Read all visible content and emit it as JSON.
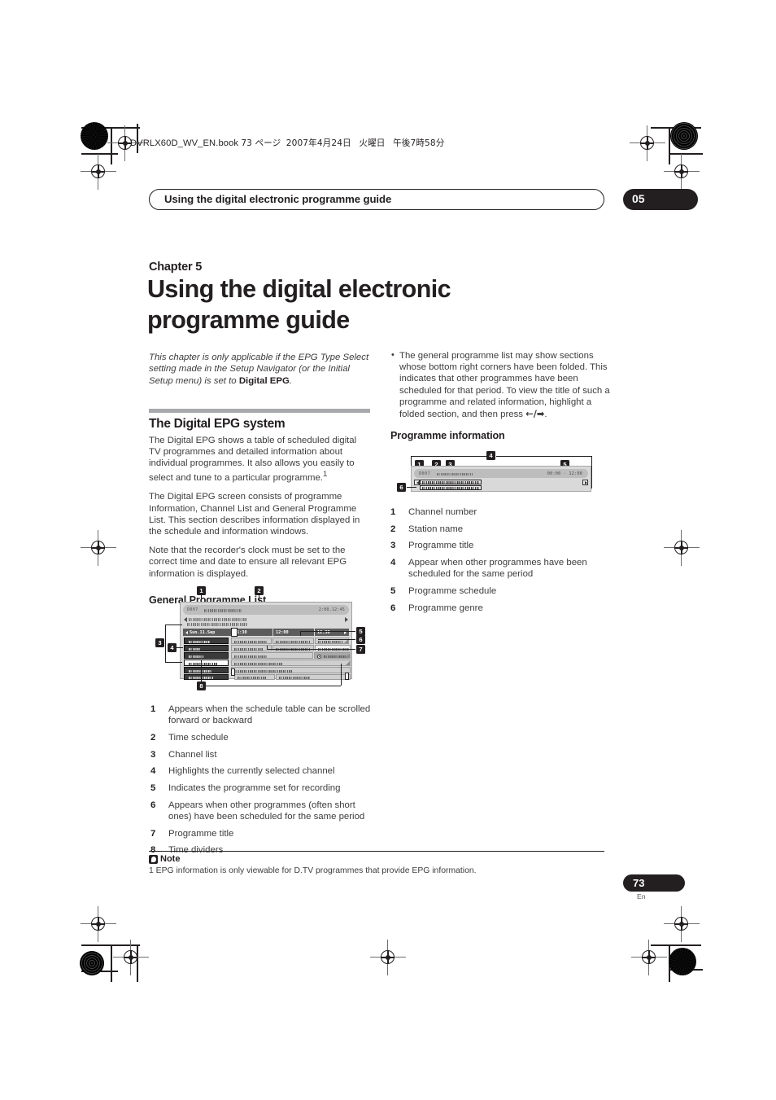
{
  "print_header": {
    "filename": "DVRLX60D_WV_EN.book",
    "page_marker": "73 ページ",
    "date": "2007年4月24日",
    "weekday": "火曜日",
    "time": "午後7時58分"
  },
  "running_head": {
    "title": "Using the digital electronic programme guide",
    "chapter_badge": "05"
  },
  "chapter": {
    "label": "Chapter 5",
    "title": "Using the digital electronic programme guide"
  },
  "left_column": {
    "intro_part1": "This chapter is only applicable if the EPG Type Select setting made in the Setup Navigator (or the Initial Setup menu) is set to ",
    "intro_bold": "Digital EPG",
    "intro_part2": ".",
    "section_title": "The Digital EPG system",
    "paragraphs": [
      "The Digital EPG shows a table of scheduled digital TV programmes and detailed information about individual programmes. It also allows you easily to select and tune to a particular programme.",
      "The Digital EPG screen consists of programme Information, Channel List and General Programme List. This section describes information displayed in the schedule and information windows.",
      "Note that the recorder's clock must be set to the correct time and date to ensure all relevant EPG information is displayed."
    ],
    "footnote_marker": "1",
    "subsection_title": "General Programme List",
    "legend": [
      "Appears when the schedule table can be scrolled forward or backward",
      "Time schedule",
      "Channel list",
      "Highlights the currently selected channel",
      "Indicates the programme set for recording",
      "Appears when other programmes (often short ones) have been scheduled for the same period",
      "Programme title",
      "Time dividers"
    ]
  },
  "right_column": {
    "bullets": [
      "The general programme list may show sections whose bottom right corners have been folded. This indicates that other programmes have been scheduled for that period. To view the title of such a programme and related information, highlight a folded section, and then press ←/→."
    ],
    "bullet_text_before_arrows": "The general programme list may show sections whose bottom right corners have been folded. This indicates that other programmes have been scheduled for that period. To view the title of such a programme and related information, highlight a folded section, and then press ",
    "bullet_arrows": "←/➡",
    "bullet_text_after_arrows": ".",
    "subsection_title": "Programme information",
    "legend": [
      "Channel number",
      "Station name",
      "Programme title",
      "Appear when other programmes have been scheduled for the same period",
      "Programme schedule",
      "Programme genre"
    ]
  },
  "note": {
    "label": "Note",
    "text": "1 EPG information is only viewable for D.TV programmes that provide EPG information."
  },
  "folio": {
    "page_number": "73",
    "language": "En"
  },
  "figure_gpl": {
    "channel_number": "D007",
    "clock": "2:00.12:45",
    "date_cell": "Sun.11.Sep",
    "time_labels": [
      "11:30",
      "12:00",
      "12:30"
    ],
    "callouts": [
      "1",
      "2",
      "3",
      "4",
      "5",
      "6",
      "7",
      "8"
    ]
  },
  "figure_pi": {
    "channel_number": "D007",
    "schedule": "00:00 - 12:00",
    "callouts": [
      "1",
      "2",
      "3",
      "4",
      "5",
      "6"
    ]
  },
  "colors": {
    "ink": "#231f20",
    "body_text": "#3e3c3d",
    "rule": "#a7a9ac",
    "screen_bg": "#d9d9d9"
  }
}
